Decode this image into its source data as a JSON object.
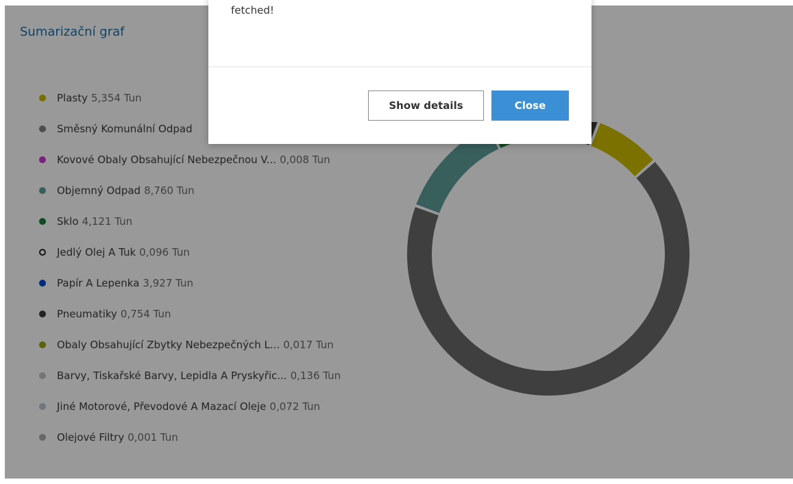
{
  "page": {
    "panel_title": "Sumarizační graf"
  },
  "legend": [
    {
      "label": "Plasty",
      "value": "5,354 Tun",
      "color": "#c8b800",
      "hollow": false
    },
    {
      "label": "Směsný Komunální Odpad",
      "value": "",
      "color": "#808080",
      "hollow": false
    },
    {
      "label": "Kovové Obaly Obsahující Nebezpečnou V...",
      "value": "0,008 Tun",
      "color": "#c43bd0",
      "hollow": false
    },
    {
      "label": "Objemný Odpad",
      "value": "8,760 Tun",
      "color": "#5f9f9a",
      "hollow": false
    },
    {
      "label": "Sklo",
      "value": "4,121 Tun",
      "color": "#1b7a3a",
      "hollow": false
    },
    {
      "label": "Jedlý Olej A Tuk",
      "value": "0,096 Tun",
      "color": "#222222",
      "hollow": true
    },
    {
      "label": "Papír A Lepenka",
      "value": "3,927 Tun",
      "color": "#0046c8",
      "hollow": false
    },
    {
      "label": "Pneumatiky",
      "value": "0,754 Tun",
      "color": "#3c3c3c",
      "hollow": false
    },
    {
      "label": "Obaly Obsahující Zbytky Nebezpečných L...",
      "value": "0,017 Tun",
      "color": "#9ba019",
      "hollow": false
    },
    {
      "label": "Barvy, Tiskařské Barvy, Lepidla A Pryskyřic...",
      "value": "0,136 Tun",
      "color": "#c9c2c2",
      "hollow": false
    },
    {
      "label": "Jiné Motorové, Převodové A Mazací Oleje",
      "value": "0,072 Tun",
      "color": "#b9c4cc",
      "hollow": false
    },
    {
      "label": "Olejové Filtry",
      "value": "0,001 Tun",
      "color": "#adadad",
      "hollow": false
    }
  ],
  "chart_data": {
    "type": "pie",
    "variant": "donut",
    "unit": "Tun",
    "categories": [
      "Plasty",
      "Směsný Komunální Odpad",
      "Kovové Obaly Obsahující Nebezpečnou V...",
      "Objemný Odpad",
      "Sklo",
      "Jedlý Olej A Tuk",
      "Papír A Lepenka",
      "Pneumatiky"
    ],
    "values": [
      5.354,
      47.0,
      0.008,
      8.76,
      4.121,
      0.096,
      3.927,
      0.754
    ],
    "colors": [
      "#cdbd00",
      "#6a6a6a",
      "#c43bd0",
      "#5f9f9a",
      "#1b7a3a",
      "#1a1a1a",
      "#0046c8",
      "#3c3c3c"
    ],
    "legend_position": "left"
  },
  "dialog": {
    "message": "fetched!",
    "show_details_label": "Show details",
    "close_label": "Close"
  }
}
